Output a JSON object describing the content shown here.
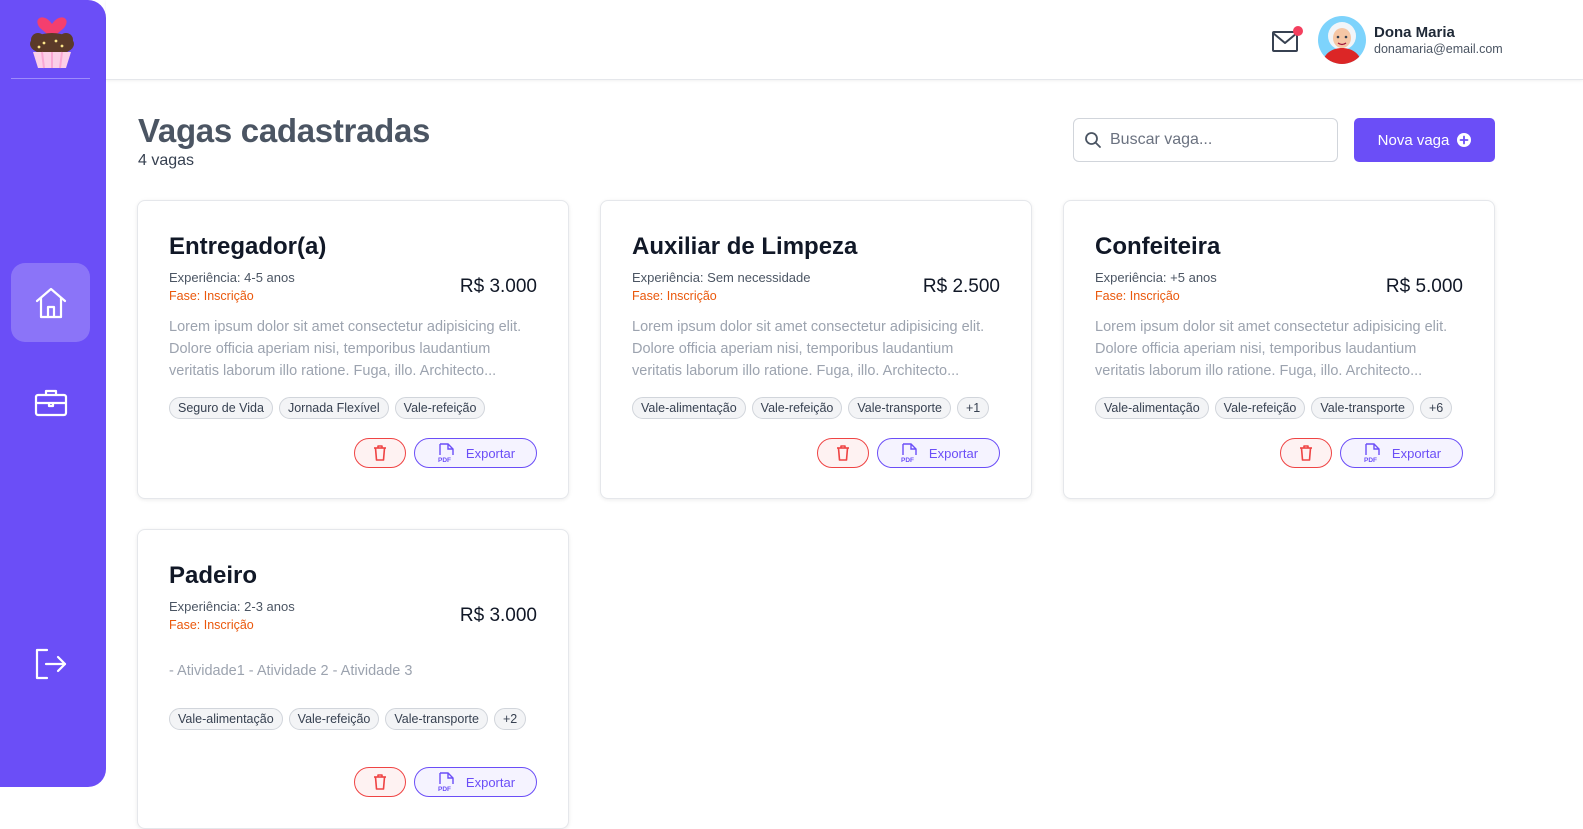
{
  "header": {
    "user_name": "Dona Maria",
    "user_email": "donamaria@email.com"
  },
  "page": {
    "title": "Vagas cadastradas",
    "count": "4 vagas",
    "search_placeholder": "Buscar vaga...",
    "new_button_label": "Nova vaga"
  },
  "cards": [
    {
      "title": "Entregador(a)",
      "experience": "Experiência: 4-5 anos",
      "phase": "Fase: Inscrição",
      "salary": "R$ 3.000",
      "description": "Lorem ipsum dolor sit amet consectetur adipisicing elit. Dolore officia aperiam nisi, temporibus laudantium veritatis laborum illo ratione. Fuga, illo. Architecto...",
      "tags": [
        "Seguro de Vida",
        "Jornada Flexível",
        "Vale-refeição"
      ],
      "export_label": "Exportar"
    },
    {
      "title": "Auxiliar de Limpeza",
      "experience": "Experiência: Sem necessidade",
      "phase": "Fase: Inscrição",
      "salary": "R$ 2.500",
      "description": "Lorem ipsum dolor sit amet consectetur adipisicing elit. Dolore officia aperiam nisi, temporibus laudantium veritatis laborum illo ratione. Fuga, illo. Architecto...",
      "tags": [
        "Vale-alimentação",
        "Vale-refeição",
        "Vale-transporte",
        "+1"
      ],
      "export_label": "Exportar"
    },
    {
      "title": "Confeiteira",
      "experience": "Experiência: +5 anos",
      "phase": "Fase: Inscrição",
      "salary": "R$ 5.000",
      "description": "Lorem ipsum dolor sit amet consectetur adipisicing elit. Dolore officia aperiam nisi, temporibus laudantium veritatis laborum illo ratione. Fuga, illo. Architecto...",
      "tags": [
        "Vale-alimentação",
        "Vale-refeição",
        "Vale-transporte",
        "+6"
      ],
      "export_label": "Exportar"
    },
    {
      "title": "Padeiro",
      "experience": "Experiência: 2-3 anos",
      "phase": "Fase: Inscrição",
      "salary": "R$ 3.000",
      "description": "- Atividade1 - Atividade 2 - Atividade 3",
      "tags": [
        "Vale-alimentação",
        "Vale-refeição",
        "Vale-transporte",
        "+2"
      ],
      "export_label": "Exportar"
    }
  ],
  "icons": {
    "logo": "cupcake-heart-icon",
    "home": "home-icon",
    "jobs": "briefcase-icon",
    "logout": "logout-icon",
    "mail": "mail-icon",
    "search": "search-icon",
    "add": "plus-circle-icon",
    "delete": "trash-icon",
    "export": "pdf-file-icon"
  },
  "colors": {
    "primary": "#6b4ef7",
    "phase": "#ea580c",
    "danger": "#ef4444",
    "notification": "#f43f5e"
  }
}
